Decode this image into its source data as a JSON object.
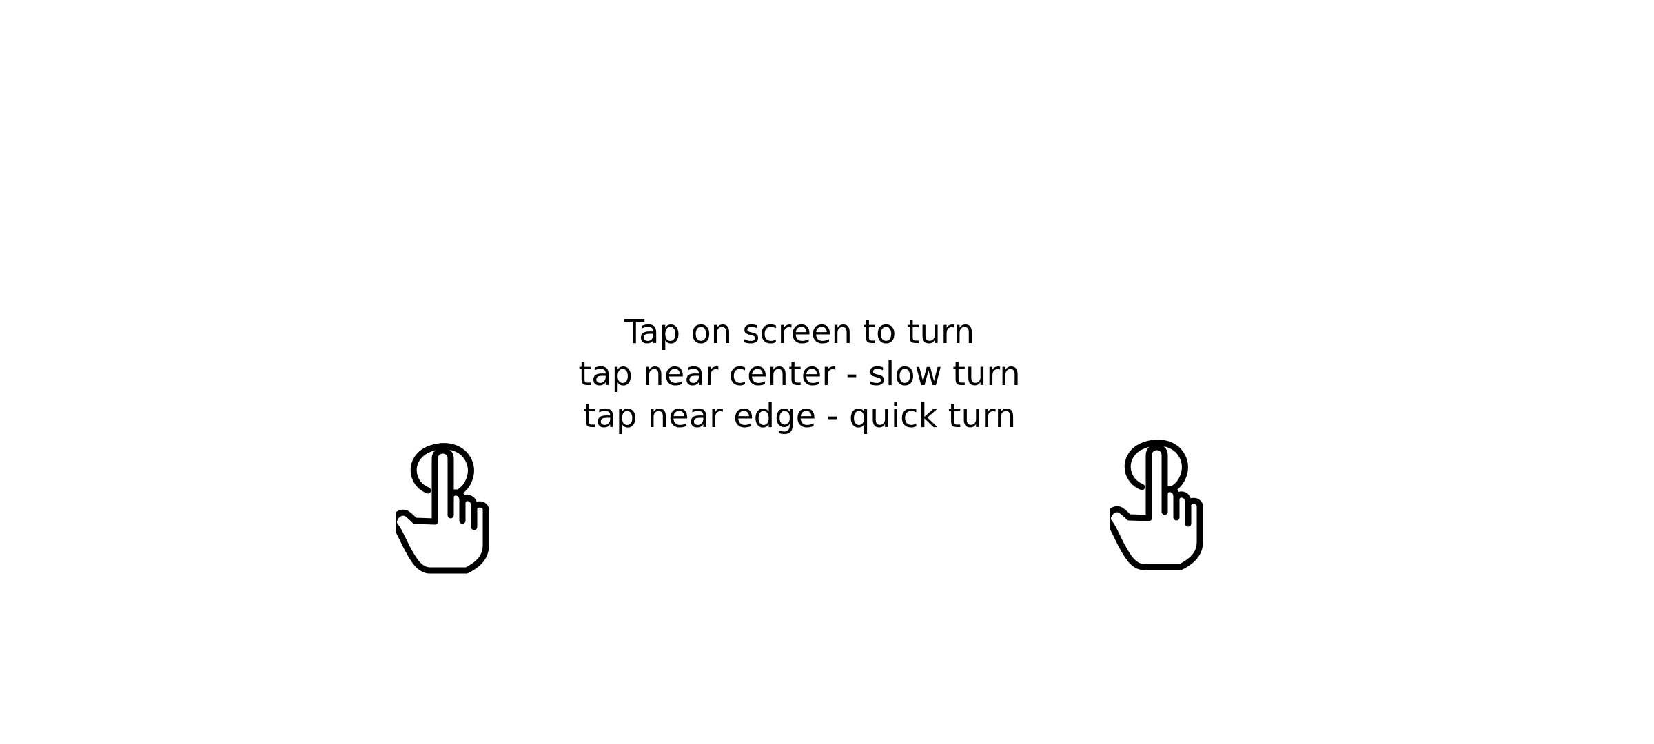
{
  "tutorial": {
    "lines": [
      "Tap on screen to turn",
      "tap near center - slow turn",
      "tap near edge - quick turn"
    ]
  },
  "icons": {
    "left": "tap-hand-icon",
    "right": "tap-hand-icon"
  },
  "colors": {
    "background": "#ffffff",
    "text": "#000000",
    "icon_stroke": "#000000"
  }
}
